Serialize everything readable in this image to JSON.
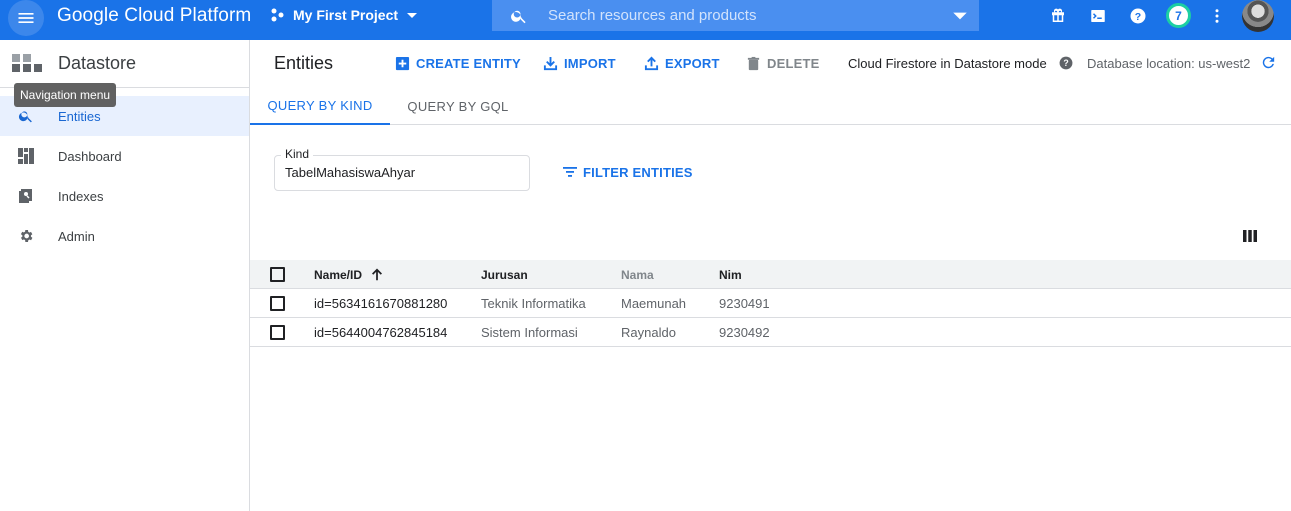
{
  "topbar": {
    "brand": "Google Cloud Platform",
    "project": "My First Project",
    "search_placeholder": "Search resources and products",
    "notification_count": "7",
    "accent": "#1a73e8"
  },
  "tooltip": "Navigation menu",
  "sidebar": {
    "title": "Datastore",
    "items": [
      {
        "label": "Entities",
        "icon": "search-icon",
        "active": true
      },
      {
        "label": "Dashboard",
        "icon": "dashboard-icon",
        "active": false
      },
      {
        "label": "Indexes",
        "icon": "indexes-icon",
        "active": false
      },
      {
        "label": "Admin",
        "icon": "gear-icon",
        "active": false
      }
    ]
  },
  "main": {
    "title": "Entities",
    "actions": {
      "create": "CREATE ENTITY",
      "import": "IMPORT",
      "export": "EXPORT",
      "delete": "DELETE"
    },
    "mode": "Cloud Firestore in Datastore mode",
    "location": "Database location: us-west2",
    "tabs": [
      {
        "label": "QUERY BY KIND",
        "active": true
      },
      {
        "label": "QUERY BY GQL",
        "active": false
      }
    ],
    "kind": {
      "label": "Kind",
      "value": "TabelMahasiswaAhyar"
    },
    "filter_label": "FILTER ENTITIES",
    "table": {
      "headers": [
        "Name/ID",
        "Jurusan",
        "Nama",
        "Nim"
      ],
      "rows": [
        [
          "id=5634161670881280",
          "Teknik Informatika",
          "Maemunah",
          "9230491"
        ],
        [
          "id=5644004762845184",
          "Sistem Informasi",
          "Raynaldo",
          "9230492"
        ]
      ]
    }
  }
}
